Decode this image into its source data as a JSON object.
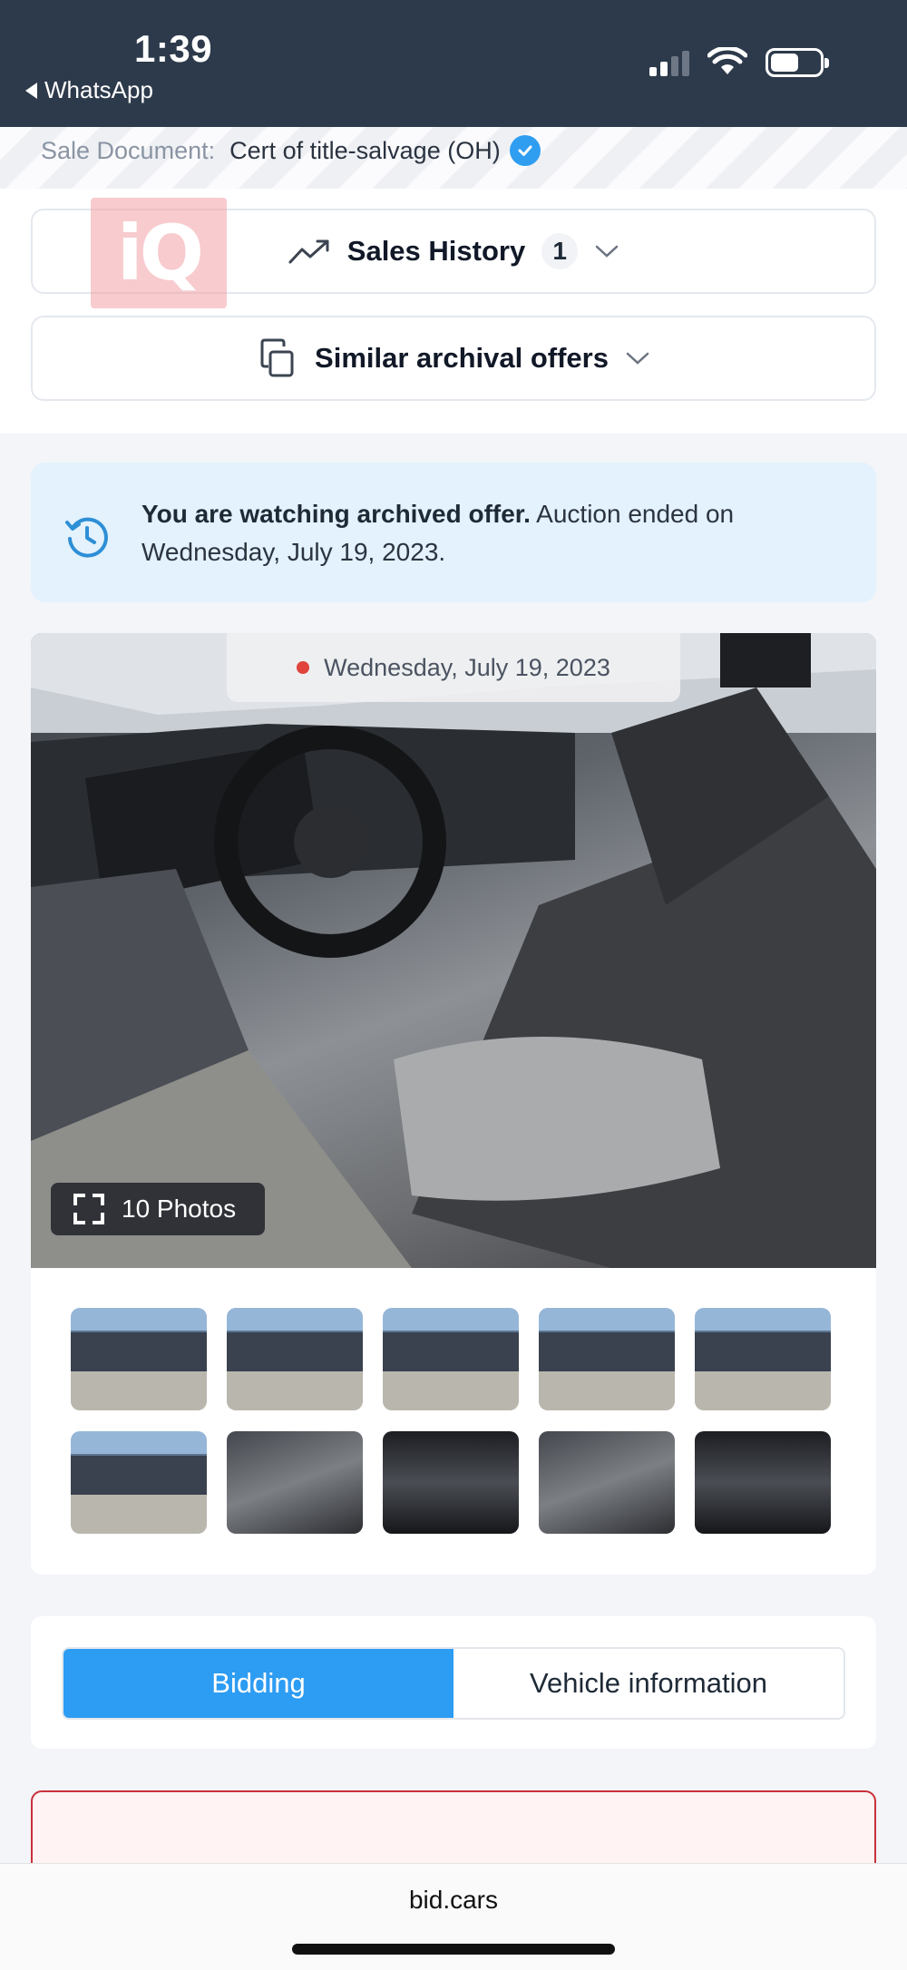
{
  "status_bar": {
    "time": "1:39",
    "back_app": "WhatsApp",
    "icons": [
      "signal-icon",
      "wifi-icon",
      "battery-icon"
    ]
  },
  "sale_document": {
    "label": "Sale Document:",
    "value": "Cert of title-salvage (OH)",
    "verified_icon": "verified-check-icon"
  },
  "watermark": {
    "text": "iQ"
  },
  "sales_history": {
    "title": "Sales History",
    "count": "1",
    "icon": "trending-up-icon"
  },
  "similar_offers": {
    "title": "Similar archival offers",
    "icon": "copy-icon"
  },
  "archive_notice": {
    "bold_text": "You are watching archived offer.",
    "text": " Auction ended on Wednesday, July 19, 2023.",
    "icon": "history-icon"
  },
  "gallery": {
    "date": "Wednesday, July 19, 2023",
    "photos_label": "10 Photos",
    "photo_count": 10,
    "thumbnails": [
      "exterior-front-left",
      "exterior-side",
      "exterior-rear-left",
      "exterior-front-damaged",
      "exterior-front",
      "exterior-rear",
      "interior-front-seats",
      "interior-dashboard",
      "instrument-cluster",
      "interior-rear-seats"
    ]
  },
  "tabs": {
    "bidding": "Bidding",
    "vehicle_info": "Vehicle information",
    "active": "Bidding"
  },
  "browser": {
    "url": "bid.cars"
  },
  "colors": {
    "status_bar": "#2d3a4b",
    "accent": "#2d9cf3",
    "notice_bg": "#e3f2fd",
    "alert_border": "#c9303b"
  }
}
